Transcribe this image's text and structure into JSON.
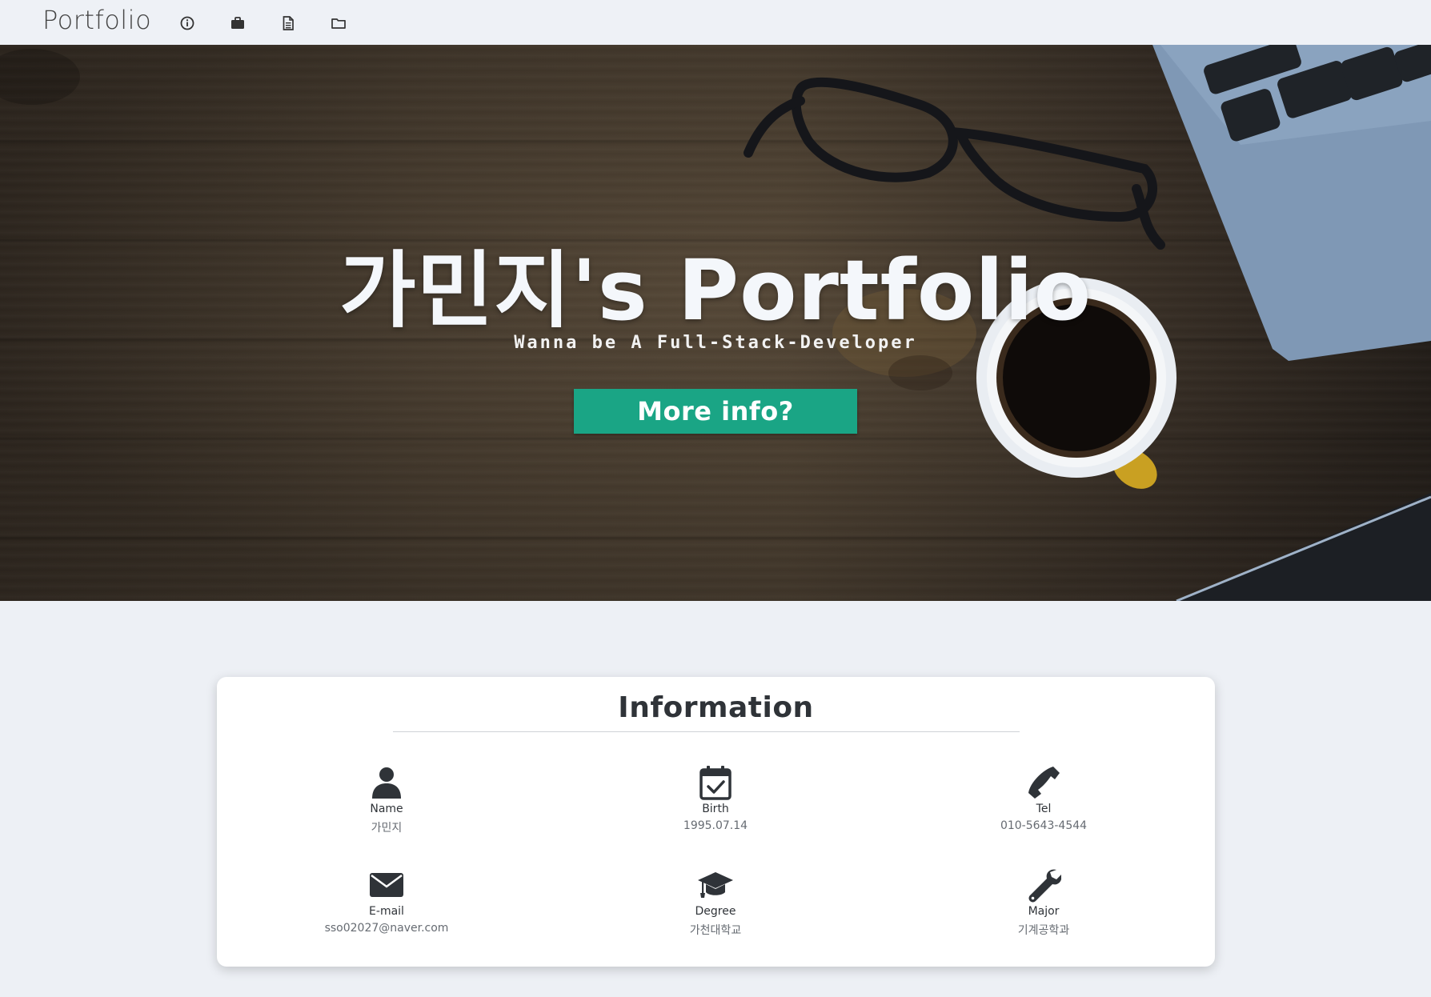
{
  "navbar": {
    "brand": "Portfolio",
    "icons": [
      "info-icon",
      "briefcase-icon",
      "document-icon",
      "folder-icon"
    ]
  },
  "hero": {
    "title": "가민지's Portfolio",
    "subtitle": "Wanna be A Full-Stack-Developer",
    "button_label": "More info?"
  },
  "information": {
    "title": "Information",
    "items": [
      {
        "icon": "user-icon",
        "label": "Name",
        "value": "가민지"
      },
      {
        "icon": "calendar-check-icon",
        "label": "Birth",
        "value": "1995.07.14"
      },
      {
        "icon": "phone-icon",
        "label": "Tel",
        "value": "010-5643-4544"
      },
      {
        "icon": "envelope-icon",
        "label": "E-mail",
        "value": "sso02027@naver.com"
      },
      {
        "icon": "graduation-cap-icon",
        "label": "Degree",
        "value": "가천대학교"
      },
      {
        "icon": "wrench-icon",
        "label": "Major",
        "value": "기계공학과"
      }
    ]
  },
  "colors": {
    "page_background": "#edf0f5",
    "accent_button": "#1aa585",
    "card_background": "#ffffff",
    "icon_dark": "#2f3338"
  }
}
